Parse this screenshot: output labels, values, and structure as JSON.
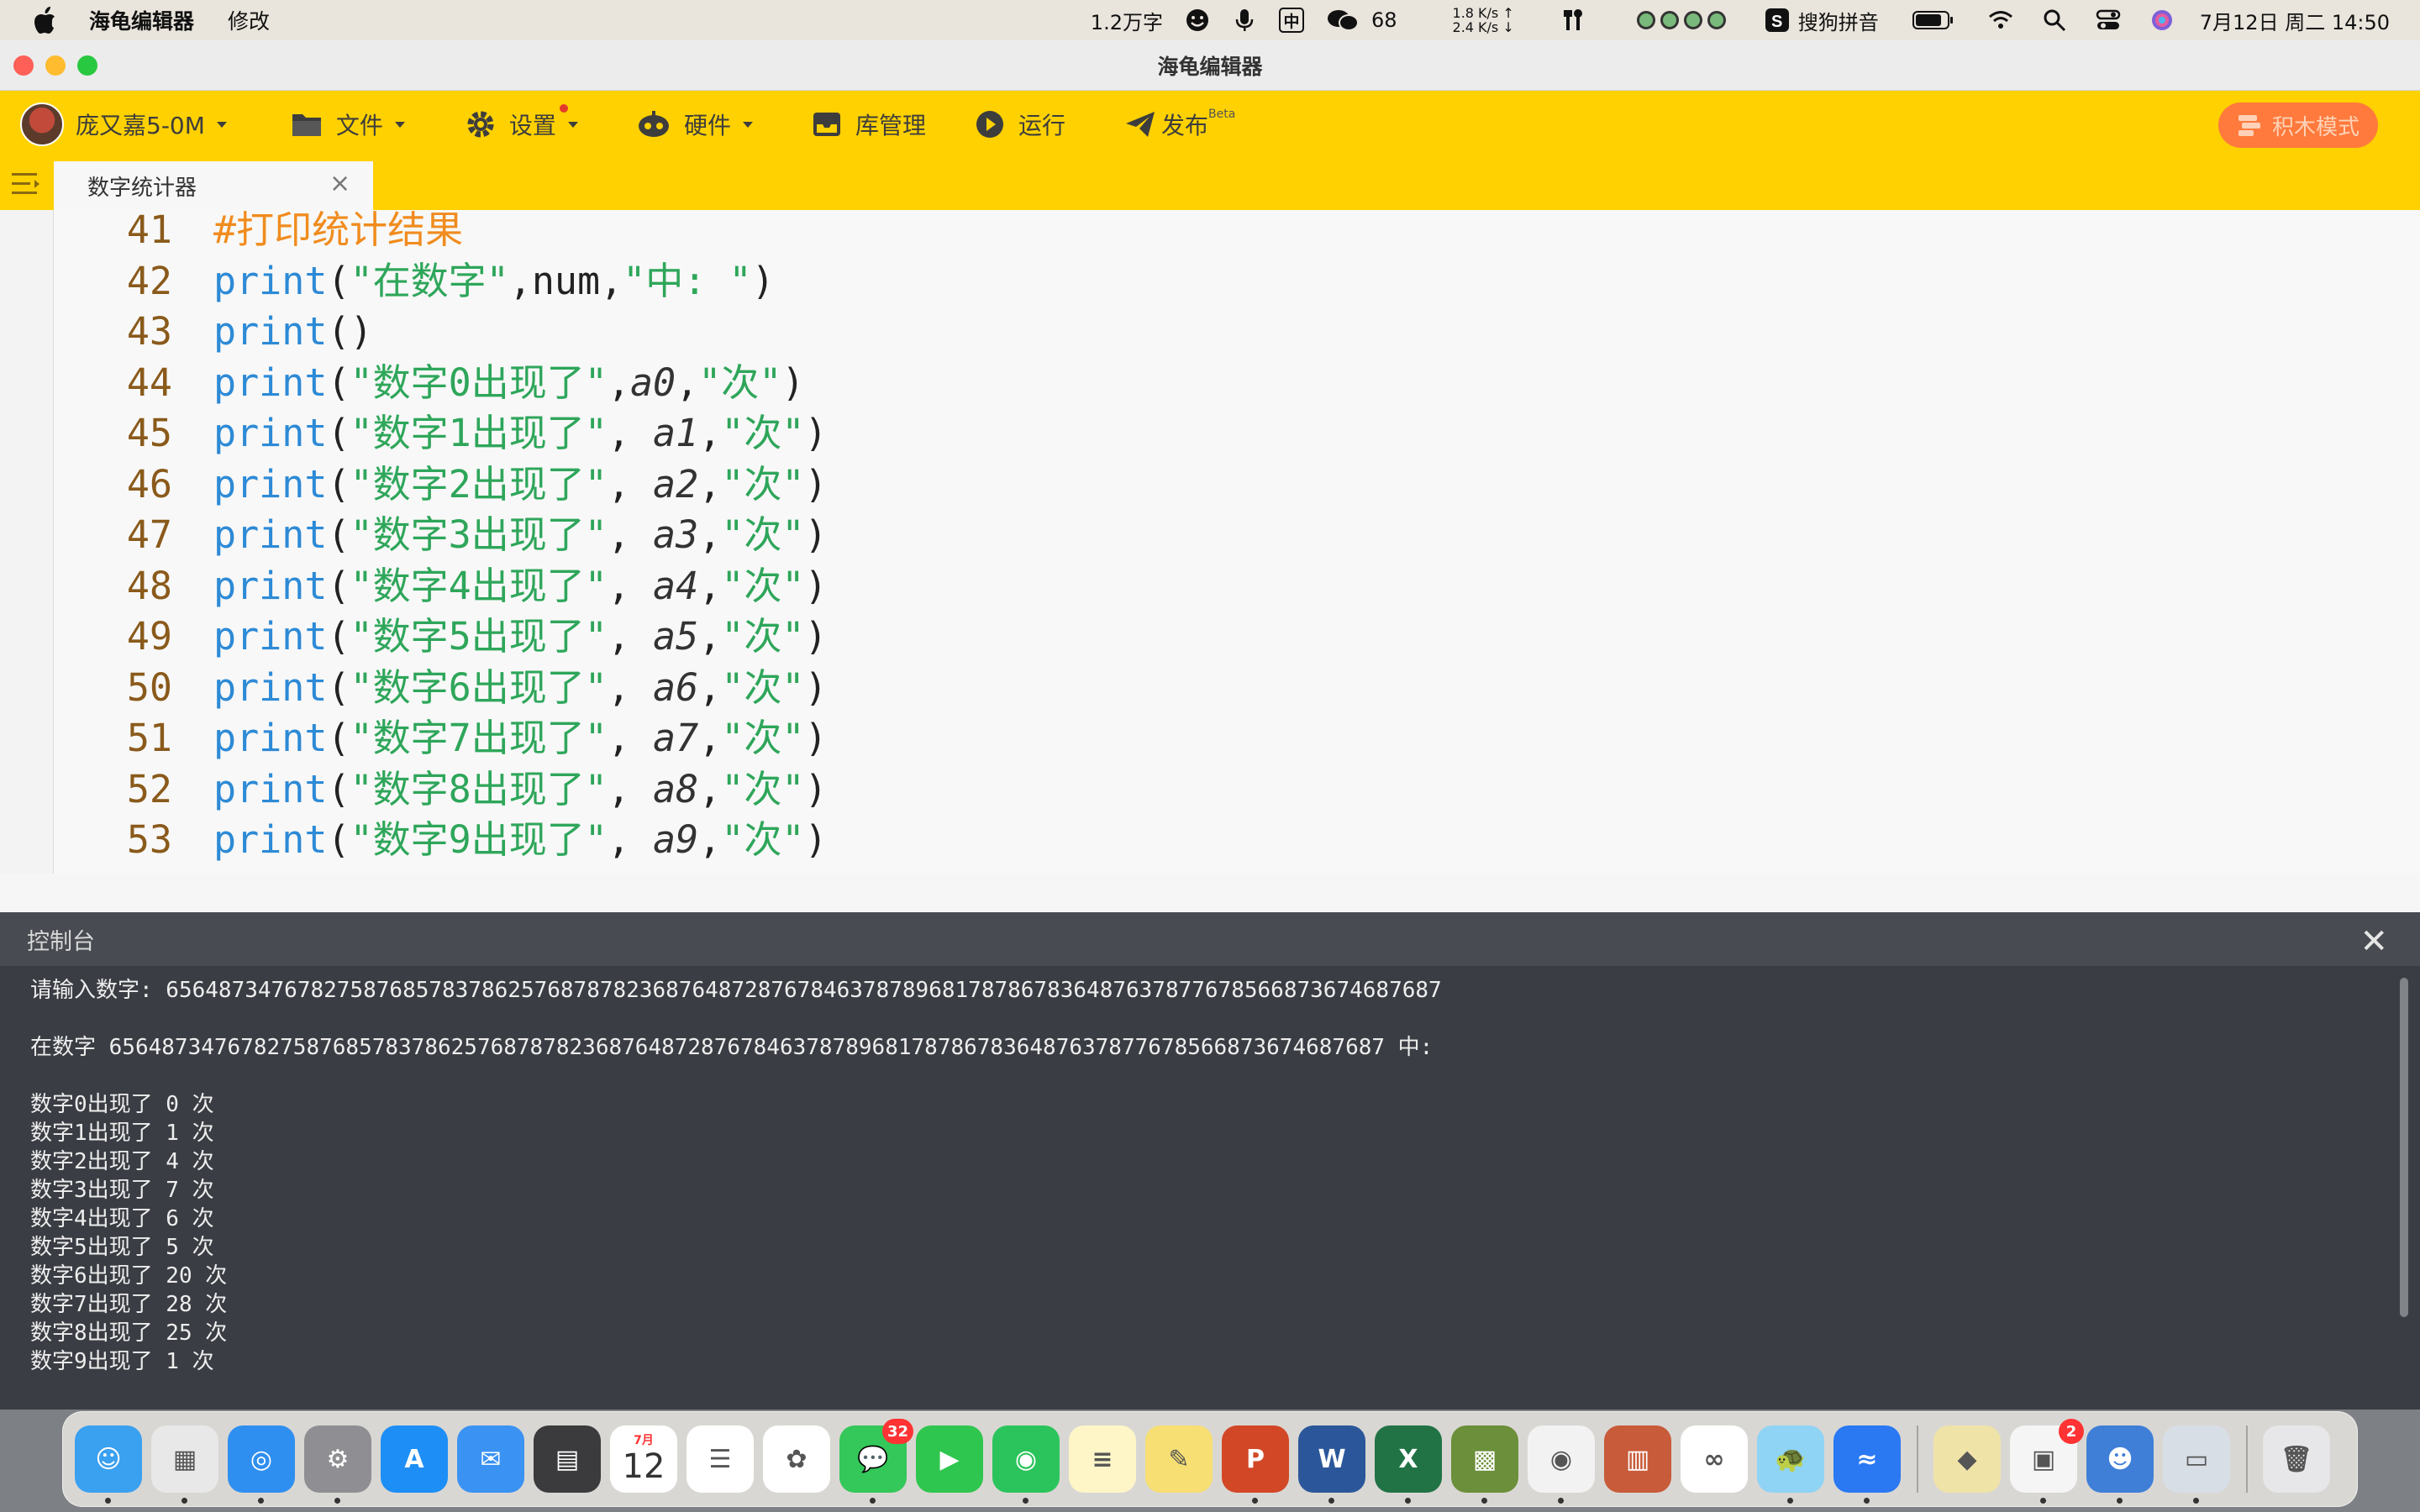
{
  "menubar": {
    "app_name": "海龟编辑器",
    "menu_edit": "修改",
    "word_count": "1.2万字",
    "ime_badge": "中",
    "wechat_count": "68",
    "net_up": "1.8 K/s ↑",
    "net_down": "2.4 K/s ↓",
    "input_method": "搜狗拼音",
    "datetime": "7月12日 周二  14:50"
  },
  "window": {
    "title": "海龟编辑器"
  },
  "toolbar": {
    "user_name": "庞又嘉5-0M",
    "file_label": "文件",
    "settings_label": "设置",
    "hardware_label": "硬件",
    "library_label": "库管理",
    "run_label": "运行",
    "publish_label": "发布",
    "publish_badge": "Beta",
    "block_mode_label": "积木模式"
  },
  "tabs": [
    {
      "label": "数字统计器",
      "close": "×"
    }
  ],
  "editor": {
    "lines": [
      {
        "num": "41",
        "parts": [
          {
            "t": "#打印统计结果",
            "c": "cmt"
          }
        ]
      },
      {
        "num": "42",
        "parts": [
          {
            "t": "print",
            "c": "kw"
          },
          {
            "t": "(",
            "c": "p"
          },
          {
            "t": "\"在数字\"",
            "c": "str"
          },
          {
            "t": ",num,",
            "c": "p"
          },
          {
            "t": "\"中: \"",
            "c": "str"
          },
          {
            "t": ")",
            "c": "p"
          }
        ]
      },
      {
        "num": "43",
        "parts": [
          {
            "t": "print",
            "c": "kw"
          },
          {
            "t": "()",
            "c": "p"
          }
        ]
      },
      {
        "num": "44",
        "parts": [
          {
            "t": "print",
            "c": "kw"
          },
          {
            "t": "(",
            "c": "p"
          },
          {
            "t": "\"数字0出现了\"",
            "c": "str"
          },
          {
            "t": ",",
            "c": "p"
          },
          {
            "t": "a0",
            "c": "var"
          },
          {
            "t": ",",
            "c": "p"
          },
          {
            "t": "\"次\"",
            "c": "str"
          },
          {
            "t": ")",
            "c": "p"
          }
        ]
      },
      {
        "num": "45",
        "parts": [
          {
            "t": "print",
            "c": "kw"
          },
          {
            "t": "(",
            "c": "p"
          },
          {
            "t": "\"数字1出现了\"",
            "c": "str"
          },
          {
            "t": ", ",
            "c": "p"
          },
          {
            "t": "a1",
            "c": "var"
          },
          {
            "t": ",",
            "c": "p"
          },
          {
            "t": "\"次\"",
            "c": "str"
          },
          {
            "t": ")",
            "c": "p"
          }
        ]
      },
      {
        "num": "46",
        "parts": [
          {
            "t": "print",
            "c": "kw"
          },
          {
            "t": "(",
            "c": "p"
          },
          {
            "t": "\"数字2出现了\"",
            "c": "str"
          },
          {
            "t": ", ",
            "c": "p"
          },
          {
            "t": "a2",
            "c": "var"
          },
          {
            "t": ",",
            "c": "p"
          },
          {
            "t": "\"次\"",
            "c": "str"
          },
          {
            "t": ")",
            "c": "p"
          }
        ]
      },
      {
        "num": "47",
        "parts": [
          {
            "t": "print",
            "c": "kw"
          },
          {
            "t": "(",
            "c": "p"
          },
          {
            "t": "\"数字3出现了\"",
            "c": "str"
          },
          {
            "t": ", ",
            "c": "p"
          },
          {
            "t": "a3",
            "c": "var"
          },
          {
            "t": ",",
            "c": "p"
          },
          {
            "t": "\"次\"",
            "c": "str"
          },
          {
            "t": ")",
            "c": "p"
          }
        ]
      },
      {
        "num": "48",
        "parts": [
          {
            "t": "print",
            "c": "kw"
          },
          {
            "t": "(",
            "c": "p"
          },
          {
            "t": "\"数字4出现了\"",
            "c": "str"
          },
          {
            "t": ", ",
            "c": "p"
          },
          {
            "t": "a4",
            "c": "var"
          },
          {
            "t": ",",
            "c": "p"
          },
          {
            "t": "\"次\"",
            "c": "str"
          },
          {
            "t": ")",
            "c": "p"
          }
        ]
      },
      {
        "num": "49",
        "parts": [
          {
            "t": "print",
            "c": "kw"
          },
          {
            "t": "(",
            "c": "p"
          },
          {
            "t": "\"数字5出现了\"",
            "c": "str"
          },
          {
            "t": ", ",
            "c": "p"
          },
          {
            "t": "a5",
            "c": "var"
          },
          {
            "t": ",",
            "c": "p"
          },
          {
            "t": "\"次\"",
            "c": "str"
          },
          {
            "t": ")",
            "c": "p"
          }
        ]
      },
      {
        "num": "50",
        "parts": [
          {
            "t": "print",
            "c": "kw"
          },
          {
            "t": "(",
            "c": "p"
          },
          {
            "t": "\"数字6出现了\"",
            "c": "str"
          },
          {
            "t": ", ",
            "c": "p"
          },
          {
            "t": "a6",
            "c": "var"
          },
          {
            "t": ",",
            "c": "p"
          },
          {
            "t": "\"次\"",
            "c": "str"
          },
          {
            "t": ")",
            "c": "p"
          }
        ]
      },
      {
        "num": "51",
        "parts": [
          {
            "t": "print",
            "c": "kw"
          },
          {
            "t": "(",
            "c": "p"
          },
          {
            "t": "\"数字7出现了\"",
            "c": "str"
          },
          {
            "t": ", ",
            "c": "p"
          },
          {
            "t": "a7",
            "c": "var"
          },
          {
            "t": ",",
            "c": "p"
          },
          {
            "t": "\"次\"",
            "c": "str"
          },
          {
            "t": ")",
            "c": "p"
          }
        ]
      },
      {
        "num": "52",
        "parts": [
          {
            "t": "print",
            "c": "kw"
          },
          {
            "t": "(",
            "c": "p"
          },
          {
            "t": "\"数字8出现了\"",
            "c": "str"
          },
          {
            "t": ", ",
            "c": "p"
          },
          {
            "t": "a8",
            "c": "var"
          },
          {
            "t": ",",
            "c": "p"
          },
          {
            "t": "\"次\"",
            "c": "str"
          },
          {
            "t": ")",
            "c": "p"
          }
        ]
      },
      {
        "num": "53",
        "parts": [
          {
            "t": "print",
            "c": "kw"
          },
          {
            "t": "(",
            "c": "p"
          },
          {
            "t": "\"数字9出现了\"",
            "c": "str"
          },
          {
            "t": ", ",
            "c": "p"
          },
          {
            "t": "a9",
            "c": "var"
          },
          {
            "t": ",",
            "c": "p"
          },
          {
            "t": "\"次\"",
            "c": "str"
          },
          {
            "t": ")",
            "c": "p"
          }
        ]
      }
    ],
    "run_button_label": "运行"
  },
  "console": {
    "title": "控制台",
    "close": "✕",
    "output": [
      "请输入数字: 6564873476782758768578378625768787823687648728767846378789681787867836487637877678566873674687687",
      "",
      "在数字 6564873476782758768578378625768787823687648728767846378789681787867836487637877678566873674687687 中:",
      "",
      "数字0出现了 0 次",
      "数字1出现了 1 次",
      "数字2出现了 4 次",
      "数字3出现了 7 次",
      "数字4出现了 6 次",
      "数字5出现了 5 次",
      "数字6出现了 20 次",
      "数字7出现了 28 次",
      "数字8出现了 25 次",
      "数字9出现了 1 次"
    ]
  },
  "dock": {
    "calendar_month": "7月",
    "calendar_day": "12",
    "messages_badge": "32",
    "office_badge": "2",
    "apps": [
      {
        "name": "finder",
        "color": "#3aa0f0",
        "glyph": "☺"
      },
      {
        "name": "launchpad",
        "color": "#e8e8e8",
        "glyph": "▦"
      },
      {
        "name": "safari",
        "color": "#2f8ff0",
        "glyph": "◎"
      },
      {
        "name": "system-settings",
        "color": "#8e8e93",
        "glyph": "⚙"
      },
      {
        "name": "app-store",
        "color": "#1d8ef5",
        "glyph": "A"
      },
      {
        "name": "mail",
        "color": "#3a92f3",
        "glyph": "✉"
      },
      {
        "name": "calculator",
        "color": "#3b3b3d",
        "glyph": "▤"
      },
      {
        "name": "calendar",
        "color": "#ffffff",
        "glyph": ""
      },
      {
        "name": "reminders",
        "color": "#ffffff",
        "glyph": "☰"
      },
      {
        "name": "photos",
        "color": "#ffffff",
        "glyph": "✿"
      },
      {
        "name": "messages",
        "color": "#34c759",
        "glyph": "💬"
      },
      {
        "name": "facetime",
        "color": "#2fc64f",
        "glyph": "▶"
      },
      {
        "name": "wechat",
        "color": "#2bc45c",
        "glyph": "◉"
      },
      {
        "name": "notes",
        "color": "#fff6c8",
        "glyph": "≡"
      },
      {
        "name": "stickies",
        "color": "#f7df74",
        "glyph": "✎"
      },
      {
        "name": "powerpoint",
        "color": "#d24726",
        "glyph": "P"
      },
      {
        "name": "word",
        "color": "#2b579a",
        "glyph": "W"
      },
      {
        "name": "excel",
        "color": "#217346",
        "glyph": "X"
      },
      {
        "name": "minecraft",
        "color": "#6b8f3a",
        "glyph": "▩"
      },
      {
        "name": "chrome",
        "color": "#f2f2f2",
        "glyph": "◉"
      },
      {
        "name": "books-stack",
        "color": "#c85b3a",
        "glyph": "▥"
      },
      {
        "name": "baidu-netdisk",
        "color": "#ffffff",
        "glyph": "∞"
      },
      {
        "name": "turtle-editor",
        "color": "#8fd3f5",
        "glyph": "🐢"
      },
      {
        "name": "lark",
        "color": "#2a78f2",
        "glyph": "≈"
      },
      {
        "name": "sep",
        "color": "",
        "glyph": ""
      },
      {
        "name": "color-picker",
        "color": "#f0e3a8",
        "glyph": "◆"
      },
      {
        "name": "microsoft-office",
        "color": "#f5f5f5",
        "glyph": "▣"
      },
      {
        "name": "game-avatar",
        "color": "#3f7fd8",
        "glyph": "☻"
      },
      {
        "name": "preview",
        "color": "#d8dee6",
        "glyph": "▭"
      },
      {
        "name": "sep",
        "color": "",
        "glyph": ""
      },
      {
        "name": "trash",
        "color": "#e7e7e9",
        "glyph": "🗑"
      }
    ]
  }
}
